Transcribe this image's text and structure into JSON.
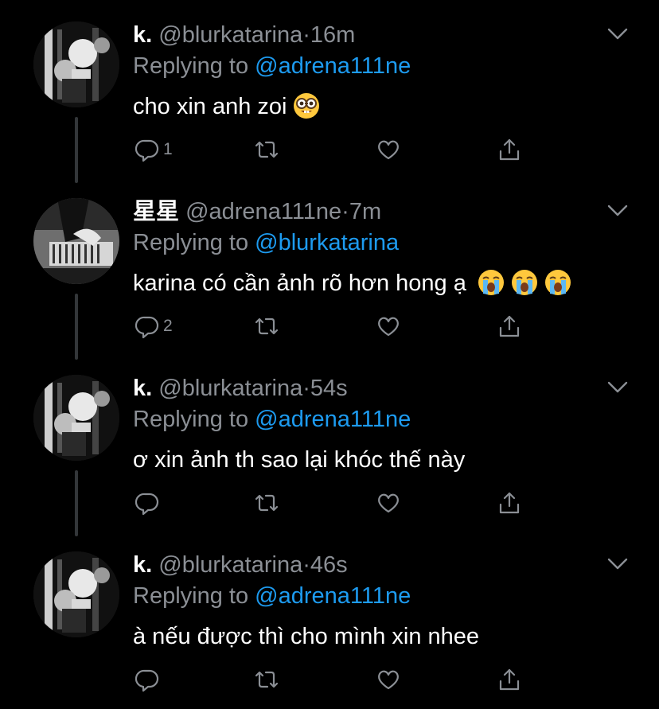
{
  "tweets": [
    {
      "display_name": "k.",
      "handle": "@blurkatarina",
      "separator": "·",
      "time": "16m",
      "reply_prefix": "Replying to",
      "reply_to": "@adrena111ne",
      "text": "cho xin anh zoi",
      "emojis": [
        "nerd-face-emoji"
      ],
      "reply_count": "1",
      "avatar": "bw-photo-avatar-katarina"
    },
    {
      "display_name": "星星",
      "handle": "@adrena111ne",
      "separator": "·",
      "time": "7m",
      "reply_prefix": "Replying to",
      "reply_to": "@blurkatarina",
      "text": "karina có cần ảnh rõ hơn hong ạ",
      "emojis": [
        "loudly-crying-face-emoji",
        "loudly-crying-face-emoji",
        "loudly-crying-face-emoji"
      ],
      "reply_count": "2",
      "avatar": "bw-photo-avatar-adrenaline"
    },
    {
      "display_name": "k.",
      "handle": "@blurkatarina",
      "separator": "·",
      "time": "54s",
      "reply_prefix": "Replying to",
      "reply_to": "@adrena111ne",
      "text": "ơ xin ảnh th sao lại khóc thế này",
      "emojis": [],
      "reply_count": "",
      "avatar": "bw-photo-avatar-katarina"
    },
    {
      "display_name": "k.",
      "handle": "@blurkatarina",
      "separator": "·",
      "time": "46s",
      "reply_prefix": "Replying to",
      "reply_to": "@adrena111ne",
      "text": "à nếu được thì cho mình xin nhee",
      "emojis": [],
      "reply_count": "",
      "avatar": "bw-photo-avatar-katarina"
    }
  ],
  "icons": {
    "reply": "reply-icon",
    "retweet": "retweet-icon",
    "like": "like-icon",
    "share": "share-icon",
    "caret": "chevron-down-icon"
  },
  "colors": {
    "background": "#000000",
    "text": "#ffffff",
    "secondary": "#8b8f95",
    "link": "#1d9bf0",
    "thread_line": "#333639"
  }
}
